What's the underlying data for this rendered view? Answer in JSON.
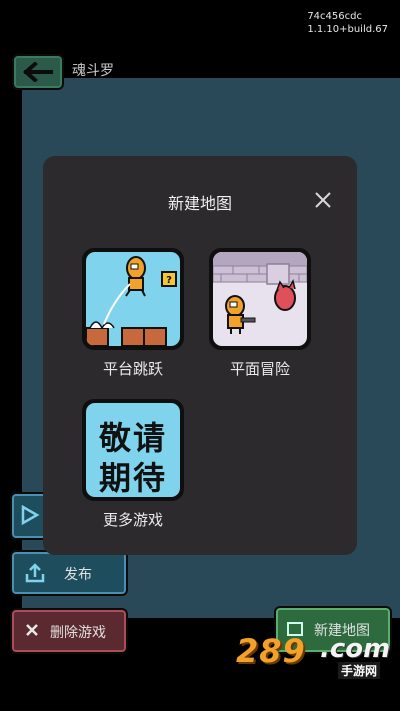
{
  "build": {
    "hash": "74c456cdc",
    "version": "1.1.10+build.67"
  },
  "page": {
    "title": "魂斗罗"
  },
  "buttons": {
    "publish": "发布",
    "delete": "删除游戏",
    "new_map": "新建地图"
  },
  "dialog": {
    "title": "新建地图",
    "options": [
      {
        "label": "平台跳跃",
        "icon": "platform-jump-thumbnail"
      },
      {
        "label": "平面冒险",
        "icon": "top-down-adventure-thumbnail"
      },
      {
        "label": "更多游戏",
        "icon": "coming-soon-thumbnail",
        "text_line1": "敬请",
        "text_line2": "期待"
      }
    ]
  },
  "watermark": {
    "number": "289",
    "domain": ".com",
    "sub": "手游网"
  },
  "colors": {
    "background": "#000000",
    "panel": "#2a4958",
    "dialog": "#2c2a2d",
    "tile_sky": "#7fd3ec",
    "green_button": "#2d6b3f",
    "red_button": "#5a2a30"
  }
}
